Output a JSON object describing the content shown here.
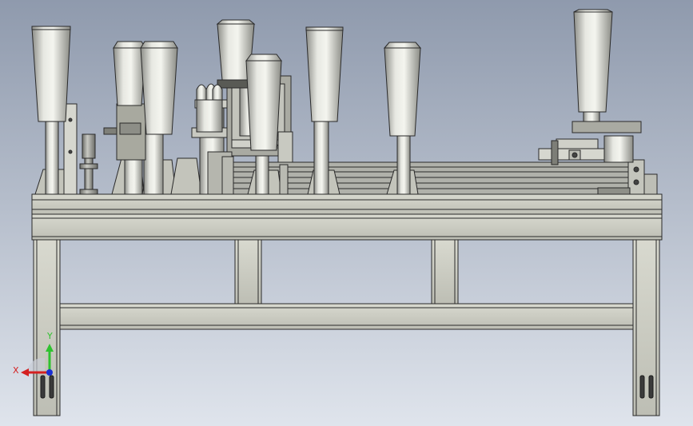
{
  "viewport": {
    "background_top": "#8f9aad",
    "background_bottom": "#dfe4ec"
  },
  "triad": {
    "x_label": "X",
    "y_label": "Y",
    "x_color": "#d42020",
    "y_color": "#2fc22f",
    "z_color": "#1a2fd4"
  },
  "model": {
    "frame_color": "#c9cac0",
    "edge_color": "#2a2a2a",
    "metal_color": "#b8b9b3",
    "icons": [
      "leveling-foot-icon",
      "triad-icon",
      "cone-icon"
    ]
  }
}
